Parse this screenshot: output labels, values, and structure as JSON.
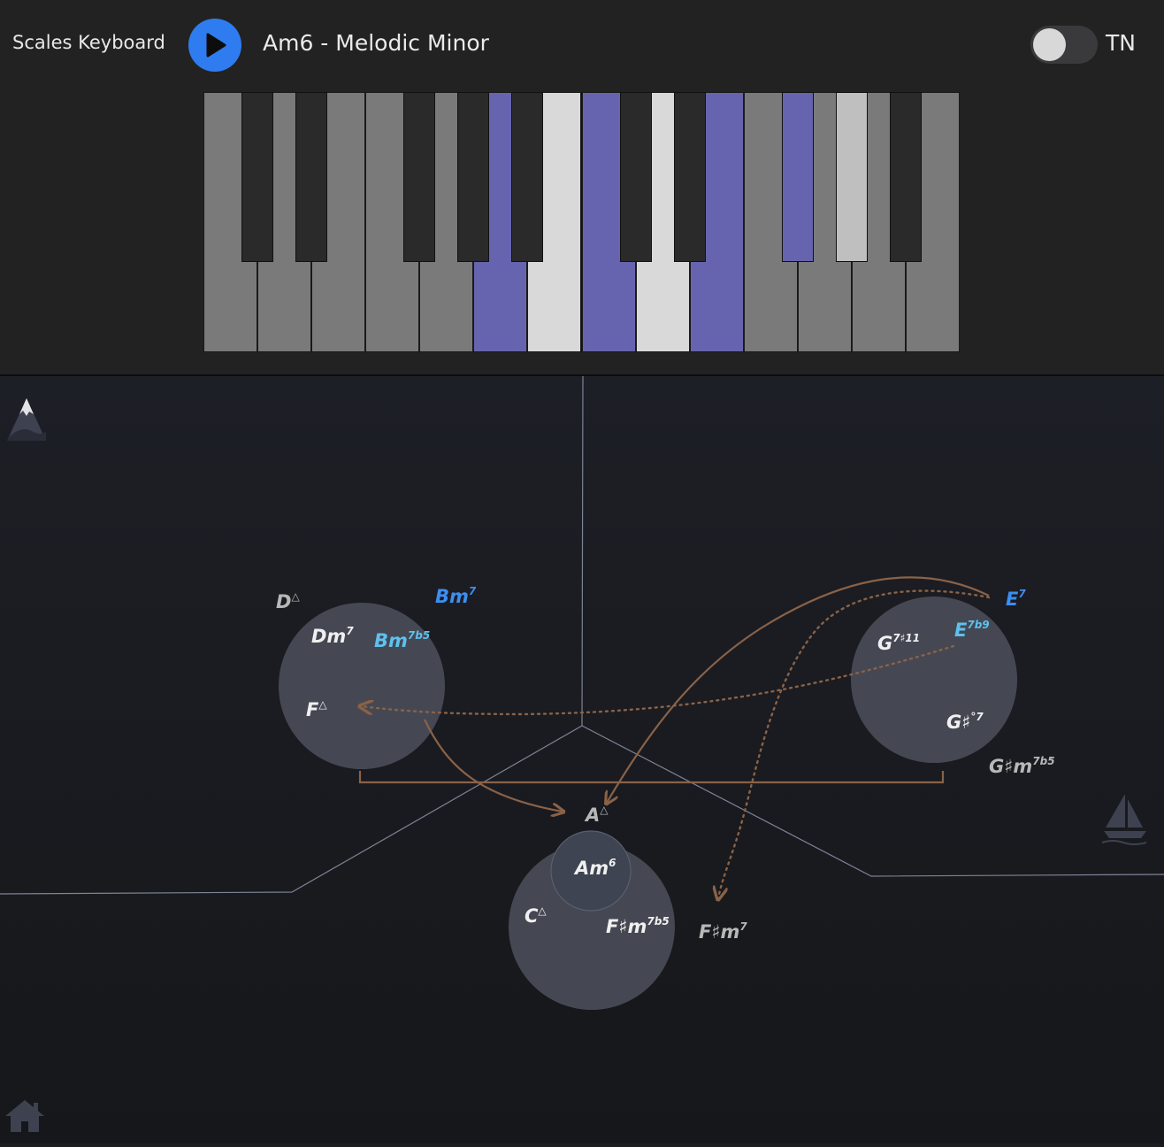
{
  "header": {
    "app_title": "Scales Keyboard",
    "scale_title": "Am6 - Melodic Minor",
    "toggle_label": "TN",
    "toggle_on": false
  },
  "keyboard": {
    "white_keys": [
      {
        "state": "inactive"
      },
      {
        "state": "inactive"
      },
      {
        "state": "inactive"
      },
      {
        "state": "inactive"
      },
      {
        "state": "inactive"
      },
      {
        "state": "chord"
      },
      {
        "state": "scale"
      },
      {
        "state": "chord"
      },
      {
        "state": "scale"
      },
      {
        "state": "chord"
      },
      {
        "state": "inactive"
      },
      {
        "state": "inactive"
      },
      {
        "state": "inactive"
      },
      {
        "state": "inactive"
      }
    ],
    "black_keys": [
      {
        "after_white": 0,
        "state": "inactive"
      },
      {
        "after_white": 1,
        "state": "inactive"
      },
      {
        "after_white": 3,
        "state": "inactive"
      },
      {
        "after_white": 4,
        "state": "inactive"
      },
      {
        "after_white": 5,
        "state": "inactive"
      },
      {
        "after_white": 7,
        "state": "inactive"
      },
      {
        "after_white": 8,
        "state": "inactive"
      },
      {
        "after_white": 10,
        "state": "chord"
      },
      {
        "after_white": 11,
        "state": "scale"
      },
      {
        "after_white": 12,
        "state": "inactive"
      }
    ],
    "colors": {
      "white_inactive": "#7a7a7a",
      "white_chord": "#6764af",
      "white_scale": "#d9d9d9",
      "black_inactive": "#2a2a2a",
      "black_chord": "#6764af",
      "black_scale": "#bfbfbf"
    }
  },
  "map": {
    "icons": [
      "mountain-icon",
      "sailboat-icon",
      "home-icon"
    ],
    "colors": {
      "circle": "#4a4e59",
      "arrow": "#8a6247",
      "divider": "#7d8497",
      "label_white": "#f0f0f0",
      "label_gray": "#b8b8b8",
      "label_blue": "#3d8ef0",
      "label_cyan": "#5ec1ee"
    },
    "chords": {
      "d_maj7": {
        "root": "D",
        "sup": "△"
      },
      "bm7": {
        "root": "Bm",
        "sup": "7"
      },
      "dm7": {
        "root": "Dm",
        "sup": "7"
      },
      "bm7b5": {
        "root": "Bm",
        "sup": "7b5"
      },
      "f_maj7": {
        "root": "F",
        "sup": "△"
      },
      "e7": {
        "root": "E",
        "sup": "7"
      },
      "g7s11": {
        "root": "G",
        "sup": "7♯11"
      },
      "e7b9": {
        "root": "E",
        "sup": "7b9"
      },
      "gsdim7": {
        "root": "G♯",
        "sup": "°7"
      },
      "gsm7b5": {
        "root": "G♯m",
        "sup": "7b5"
      },
      "a_maj7": {
        "root": "A",
        "sup": "△"
      },
      "am6": {
        "root": "Am",
        "sup": "6"
      },
      "c_maj7": {
        "root": "C",
        "sup": "△"
      },
      "fsm7b5": {
        "root": "F♯m",
        "sup": "7b5"
      },
      "fsm7": {
        "root": "F♯m",
        "sup": "7"
      }
    }
  }
}
